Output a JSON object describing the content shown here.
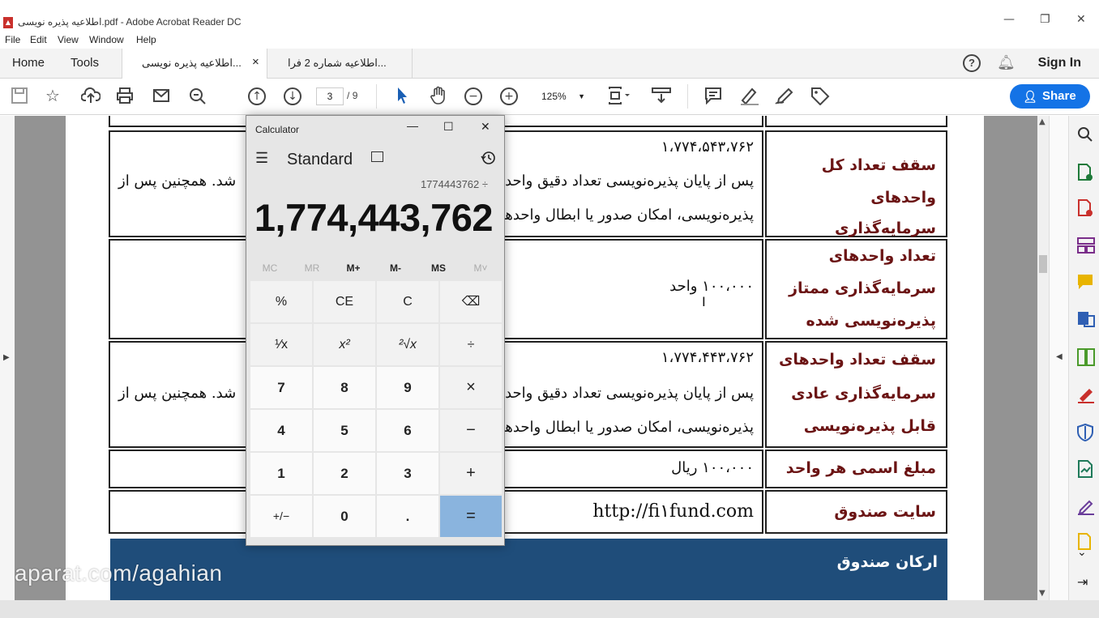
{
  "window": {
    "title": "اطلاعیه پذیره نویسی.pdf - Adobe Acrobat Reader DC",
    "controls": {
      "minimize": "—",
      "restore": "❐",
      "close": "✕"
    }
  },
  "menu": [
    "File",
    "Edit",
    "View",
    "Window",
    "Help"
  ],
  "tabs": {
    "home": "Home",
    "tools": "Tools",
    "documents": [
      {
        "label": "اطلاعیه پذیره نویسی...",
        "close": "×",
        "active": true
      },
      {
        "label": "اطلاعیه شماره 2 فرا...",
        "active": false
      }
    ],
    "help_icon": "?",
    "sign_in": "Sign In"
  },
  "toolbar": {
    "current_page": "3",
    "page_separator": "/",
    "total_pages": "9",
    "zoom": "125%",
    "share": "Share"
  },
  "document": {
    "rows": [
      {
        "label": "سقف تعداد کل واحدهای سرمایه‌گذاری",
        "label_lines": [
          "سقف تعداد کل",
          "واحدهای سرمایه‌گذاری"
        ],
        "value_lines": [
          "۱،۷۷۴،۵۴۳،۷۶۲",
          "پس از پایان پذیره‌نویسی تعداد دقیق واحد",
          "پذیره‌نویسی، امکان صدور یا ابطال واحدها"
        ],
        "overflow_text": "شد. همچنین پس از"
      },
      {
        "label_lines": [
          "تعداد واحدهای",
          "سرمایه‌گذاری ممتاز",
          "پذیره‌نویسی شده"
        ],
        "value_lines": [
          "۱۰۰،۰۰۰ واحد"
        ]
      },
      {
        "label_lines": [
          "سقف تعداد واحدهای",
          "سرمایه‌گذاری عادی",
          "قابل پذیره‌نویسی"
        ],
        "value_lines": [
          "۱،۷۷۴،۴۴۳،۷۶۲",
          "پس از پایان پذیره‌نویسی تعداد دقیق واحد",
          "پذیره‌نویسی، امکان صدور یا ابطال واحدها"
        ],
        "overflow_text": "شد. همچنین پس از"
      },
      {
        "label_lines": [
          "مبلغ اسمی هر واحد"
        ],
        "value_lines": [
          "۱۰۰،۰۰۰ ریال"
        ]
      },
      {
        "label_lines": [
          "سایت صندوق"
        ],
        "value_lines": [
          "http://fi۱fund.com"
        ]
      }
    ],
    "section_header": "ارکان صندوق"
  },
  "watermark": "aparat.com/agahian",
  "calculator": {
    "title": "Calculator",
    "mode": "Standard",
    "expression": "1774443762 ÷",
    "display": "1,774,443,762",
    "memory": [
      {
        "label": "MC",
        "enabled": false
      },
      {
        "label": "MR",
        "enabled": false
      },
      {
        "label": "M+",
        "enabled": true
      },
      {
        "label": "M-",
        "enabled": true
      },
      {
        "label": "MS",
        "enabled": true
      },
      {
        "label": "M˅",
        "enabled": false
      }
    ],
    "keys": [
      [
        "%",
        "CE",
        "C",
        "⌫"
      ],
      [
        "¹⁄x",
        "x²",
        "²√x",
        "÷"
      ],
      [
        "7",
        "8",
        "9",
        "×"
      ],
      [
        "4",
        "5",
        "6",
        "−"
      ],
      [
        "1",
        "2",
        "3",
        "+"
      ],
      [
        "+/−",
        "0",
        ".",
        "="
      ]
    ]
  },
  "colors": {
    "accent": "#1473e6",
    "label_text": "#6b1414",
    "section_band": "#1f4d7a",
    "calc_equals": "#8ab4de"
  }
}
